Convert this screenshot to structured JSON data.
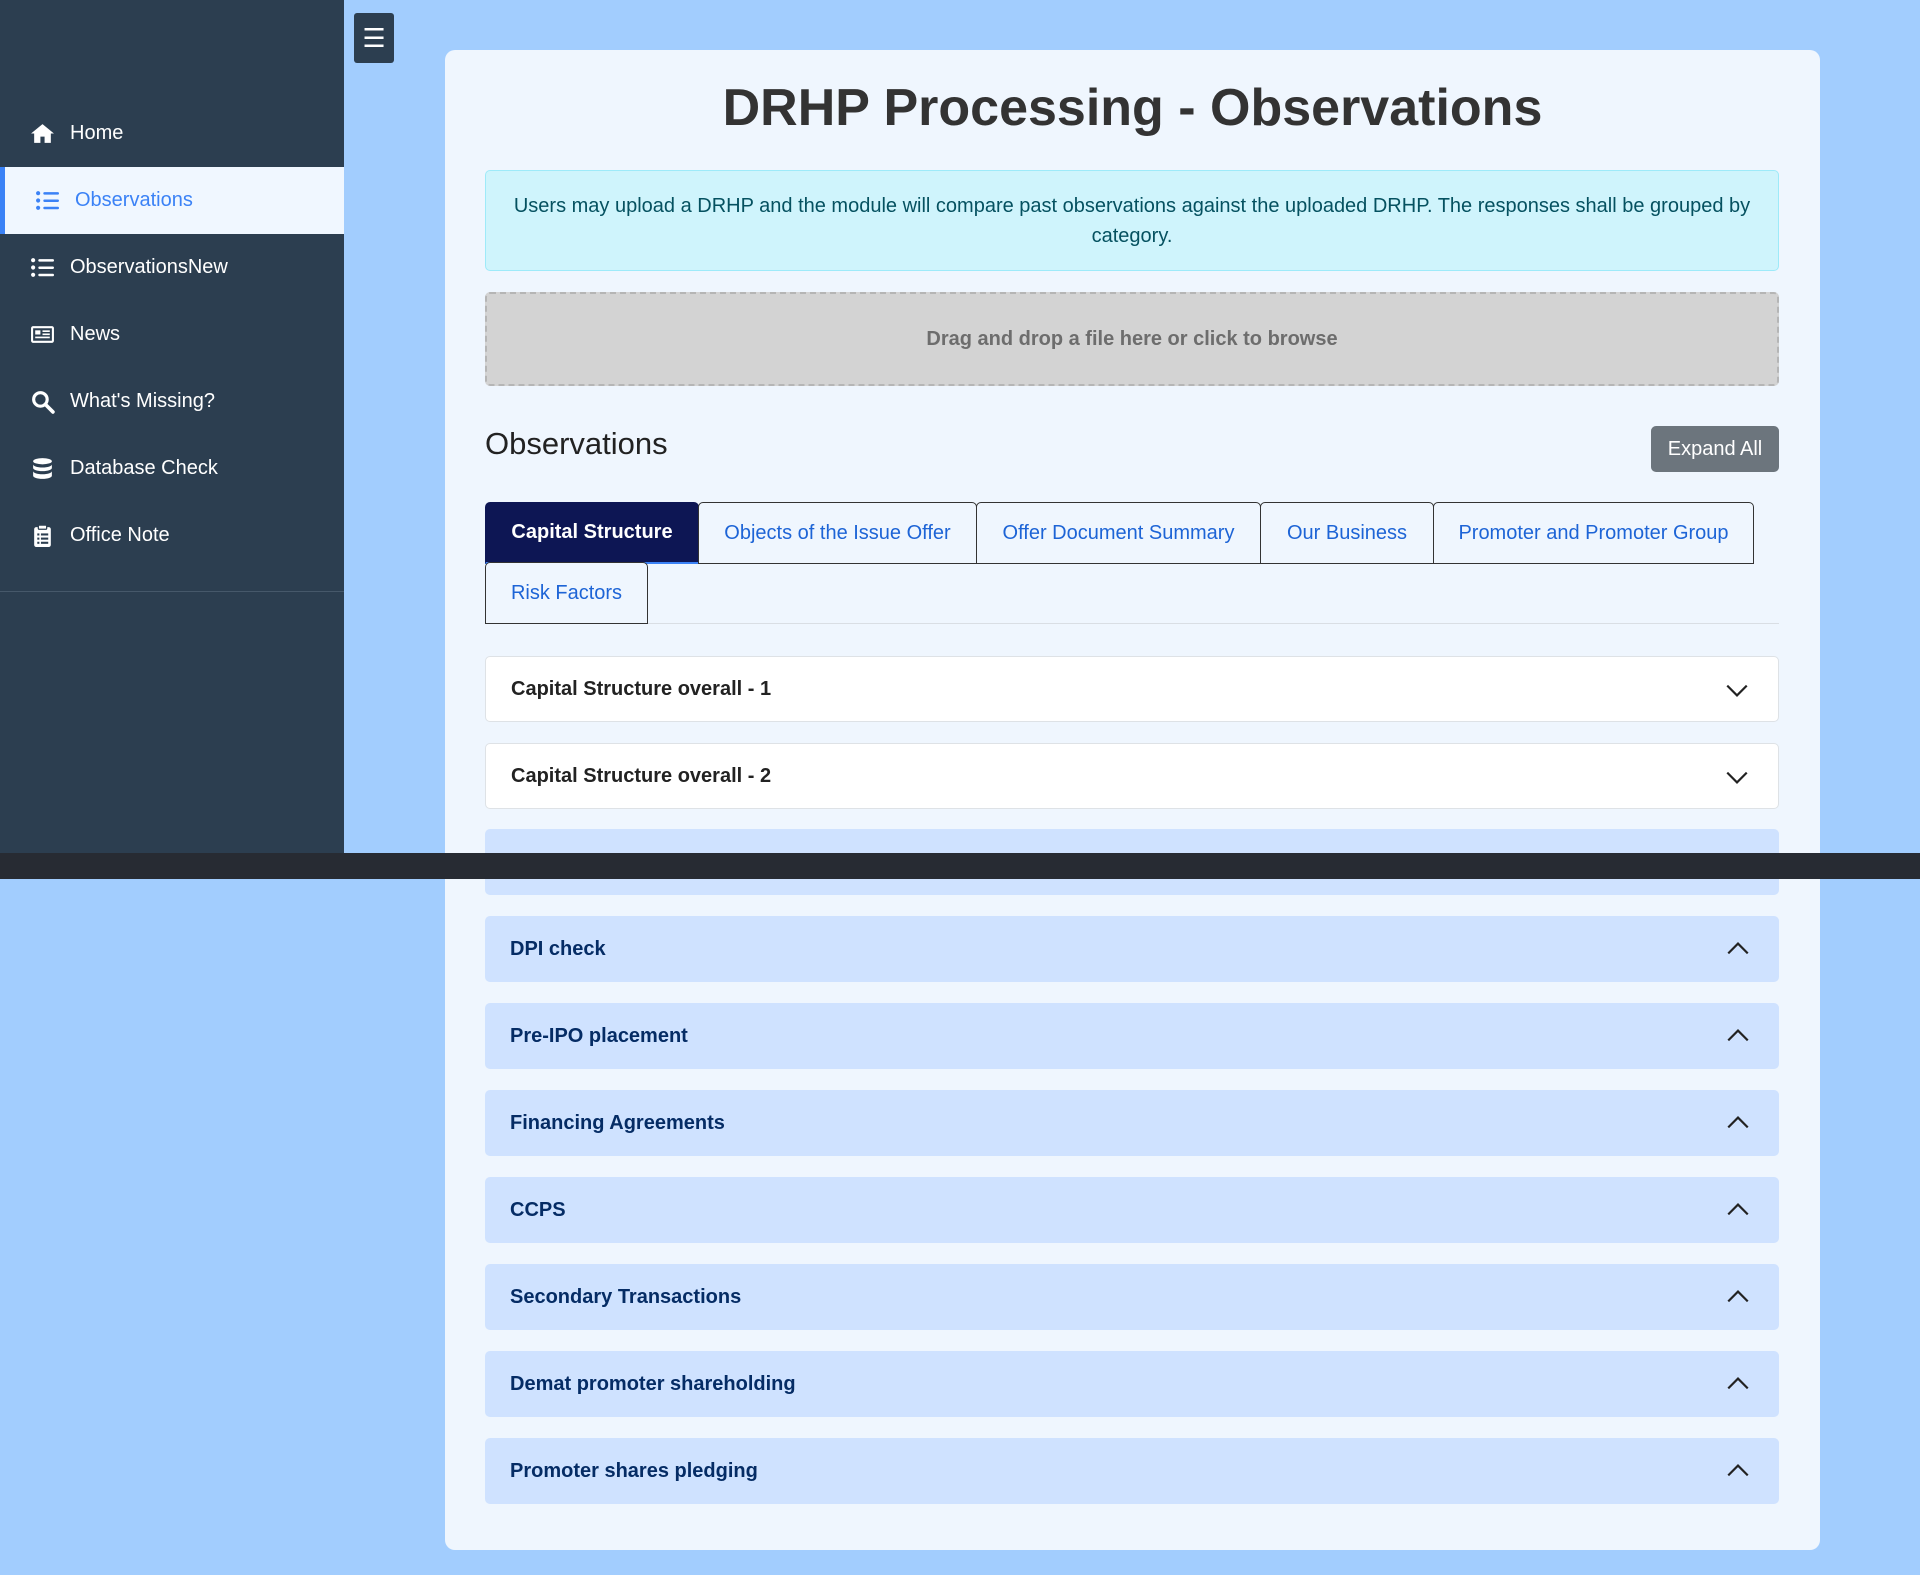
{
  "sidebar": {
    "items": [
      {
        "label": "Home",
        "icon": "home-icon"
      },
      {
        "label": "Observations",
        "icon": "list-icon",
        "active": true
      },
      {
        "label": "ObservationsNew",
        "icon": "list-icon"
      },
      {
        "label": "News",
        "icon": "newspaper-icon"
      },
      {
        "label": "What's Missing?",
        "icon": "search-icon"
      },
      {
        "label": "Database Check",
        "icon": "database-icon"
      },
      {
        "label": "Office Note",
        "icon": "clipboard-icon"
      }
    ]
  },
  "toggle_icon": "☰",
  "main": {
    "title": "DRHP Processing - Observations",
    "info": "Users may upload a DRHP and the module will compare past observations against the uploaded DRHP. The responses shall be grouped by category.",
    "dropzone": "Drag and drop a file here or click to browse",
    "section_title": "Observations",
    "expand_all": "Expand All",
    "tabs": [
      {
        "label": "Capital Structure",
        "active": true
      },
      {
        "label": "Objects of the Issue Offer"
      },
      {
        "label": "Offer Document Summary"
      },
      {
        "label": "Our Business"
      },
      {
        "label": "Promoter and Promoter Group"
      },
      {
        "label": "Risk Factors"
      }
    ],
    "accordions": [
      {
        "label": "Capital Structure overall - 1",
        "state": "closed"
      },
      {
        "label": "Capital Structure overall - 2",
        "state": "closed"
      },
      {
        "label": "",
        "state": "open"
      },
      {
        "label": "DPI check",
        "state": "open"
      },
      {
        "label": "Pre-IPO placement",
        "state": "open"
      },
      {
        "label": "Financing Agreements",
        "state": "open"
      },
      {
        "label": "CCPS",
        "state": "open"
      },
      {
        "label": "Secondary Transactions",
        "state": "open"
      },
      {
        "label": "Demat promoter shareholding",
        "state": "open"
      },
      {
        "label": "Promoter shares pledging",
        "state": "open"
      }
    ]
  },
  "colors": {
    "background": "#a2cdfe",
    "sidebar": "#2c3e50",
    "accent": "#3b82f6",
    "active_tab": "#0d1654",
    "accordion_open": "#cfe2ff"
  }
}
